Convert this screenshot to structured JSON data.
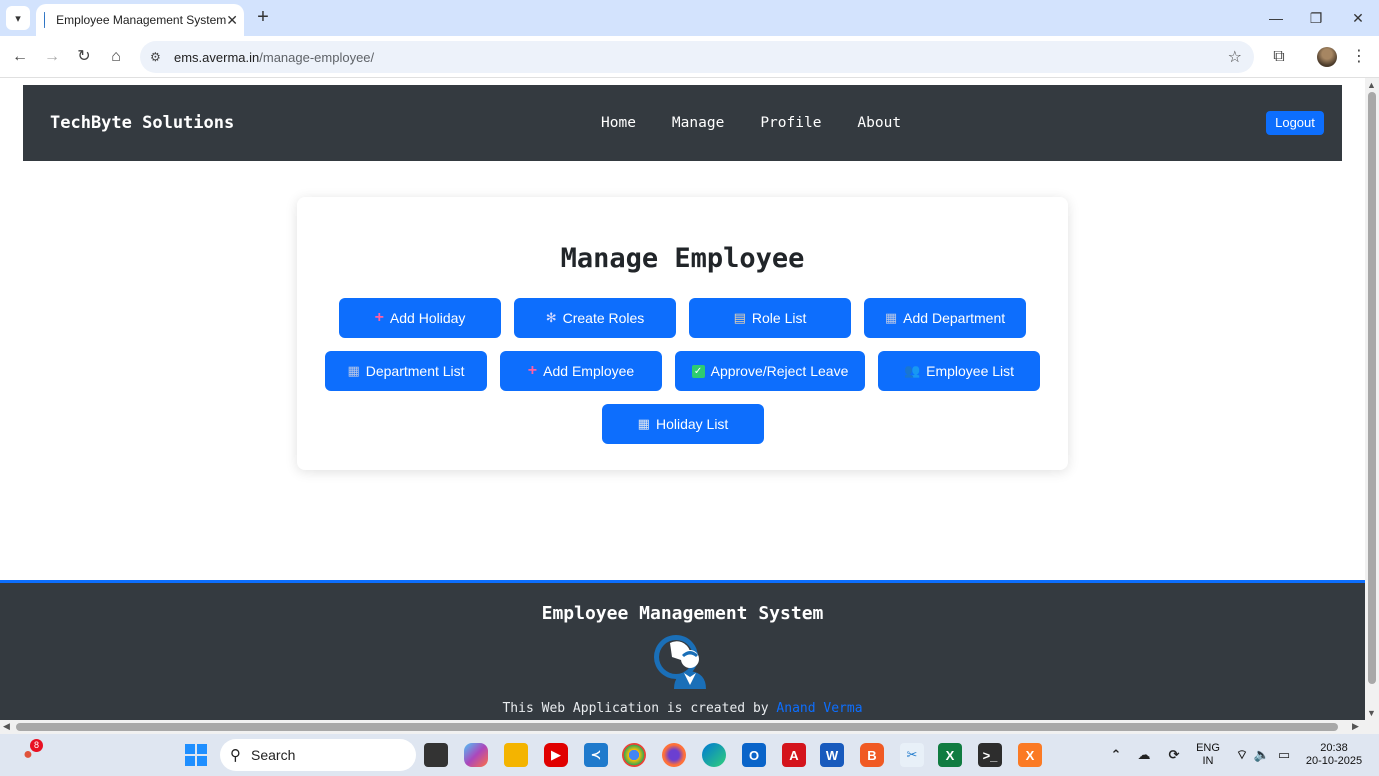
{
  "browser": {
    "tab_title": "Employee Management System",
    "tab_close": "✕",
    "new_tab": "+",
    "url_domain": "ems.averma.in",
    "url_path": "/manage-employee/",
    "win_minimize": "—",
    "win_restore": "❐",
    "win_close": "✕"
  },
  "header": {
    "brand": "TechByte Solutions",
    "nav": [
      "Home",
      "Manage",
      "Profile",
      "About"
    ],
    "logout": "Logout"
  },
  "main": {
    "title": "Manage Employee",
    "buttons": [
      {
        "label": "Add Holiday",
        "icon": "plus-icon"
      },
      {
        "label": "Create Roles",
        "icon": "gear-icon"
      },
      {
        "label": "Role List",
        "icon": "clipboard-icon"
      },
      {
        "label": "Add Department",
        "icon": "building-icon"
      },
      {
        "label": "Department List",
        "icon": "building-icon"
      },
      {
        "label": "Add Employee",
        "icon": "plus-icon"
      },
      {
        "label": "Approve/Reject Leave",
        "icon": "check-icon"
      },
      {
        "label": "Employee List",
        "icon": "people-icon"
      },
      {
        "label": "Holiday List",
        "icon": "calendar-icon"
      }
    ]
  },
  "footer": {
    "title": "Employee Management System",
    "credit_prefix": "This Web Application is created by ",
    "credit_name": "Anand Verma"
  },
  "taskbar": {
    "search": "Search",
    "notification_count": "8",
    "lang_top": "ENG",
    "lang_bottom": "IN",
    "time": "20:38",
    "date": "20-10-2025"
  },
  "colors": {
    "primary": "#0d6efd",
    "dark": "#343a40"
  }
}
